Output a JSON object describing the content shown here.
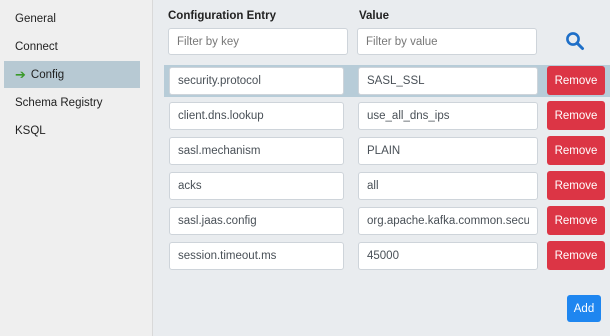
{
  "sidebar": {
    "items": [
      {
        "label": "General",
        "active": false
      },
      {
        "label": "Connect",
        "active": false
      },
      {
        "label": "Config",
        "active": true
      },
      {
        "label": "Schema Registry",
        "active": false
      },
      {
        "label": "KSQL",
        "active": false
      }
    ],
    "active_icon": "arrow-right-icon"
  },
  "table": {
    "key_header": "Configuration Entry",
    "value_header": "Value",
    "key_filter_placeholder": "Filter by key",
    "value_filter_placeholder": "Filter by value",
    "search_icon": "search-icon",
    "remove_label": "Remove",
    "rows": [
      {
        "key": "security.protocol",
        "value": "SASL_SSL",
        "highlighted": true
      },
      {
        "key": "client.dns.lookup",
        "value": "use_all_dns_ips",
        "highlighted": false
      },
      {
        "key": "sasl.mechanism",
        "value": "PLAIN",
        "highlighted": false
      },
      {
        "key": "acks",
        "value": "all",
        "highlighted": false
      },
      {
        "key": "sasl.jaas.config",
        "value": "org.apache.kafka.common.security",
        "highlighted": false
      },
      {
        "key": "session.timeout.ms",
        "value": "45000",
        "highlighted": false
      }
    ]
  },
  "add_label": "Add",
  "colors": {
    "accent": "#1e86f0",
    "danger": "#dc3545",
    "highlight": "#b7ccd8",
    "active_nav": "#b7c9d3",
    "arrow": "#3a9a2a"
  }
}
